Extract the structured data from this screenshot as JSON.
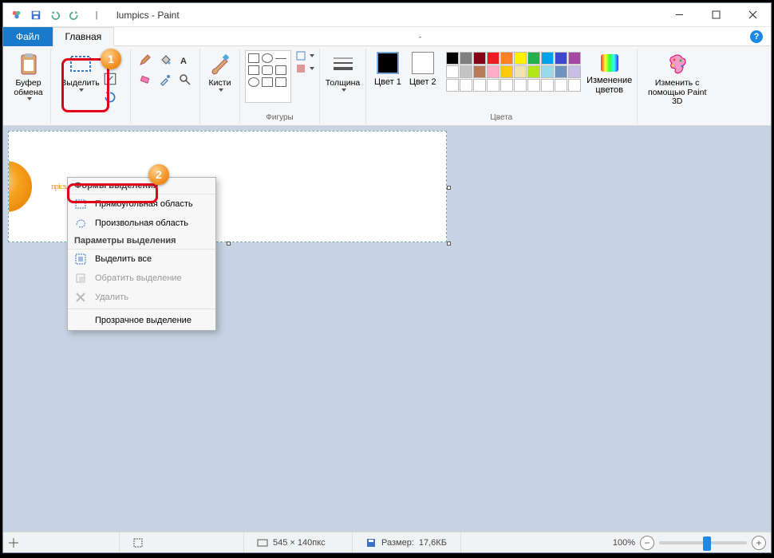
{
  "window": {
    "title": "lumpics - Paint"
  },
  "tabs": {
    "file": "Файл",
    "home": "Главная"
  },
  "ribbon": {
    "clipboard": {
      "label": "Буфер обмена",
      "paste": "Буфер обмена"
    },
    "image": {
      "select": "Выделить"
    },
    "tools": {},
    "brushes": {
      "label": "Кисти"
    },
    "shapes": {
      "label": "Фигуры"
    },
    "thickness": {
      "label": "Толщина"
    },
    "colors": {
      "label": "Цвета",
      "color1": "Цвет 1",
      "color2": "Цвет 2",
      "edit": "Изменение цветов"
    },
    "paint3d": {
      "label": "Изменить с помощью Paint 3D"
    }
  },
  "dropdown": {
    "header1": "Формы выделения",
    "rect": "Прямоугольная область",
    "free": "Произвольная область",
    "header2": "Параметры выделения",
    "all": "Выделить все",
    "invert": "Обратить выделение",
    "delete": "Удалить",
    "transparent": "Прозрачное выделение"
  },
  "canvas": {
    "text": "npics.ru"
  },
  "status": {
    "dims": "545 × 140пкс",
    "size_label": "Размер:",
    "size_val": "17,6КБ",
    "zoom": "100%"
  },
  "palette_colors": [
    "#000000",
    "#7f7f7f",
    "#880015",
    "#ed1c24",
    "#ff7f27",
    "#fff200",
    "#22b14c",
    "#00a2e8",
    "#3f48cc",
    "#a349a4",
    "#ffffff",
    "#c3c3c3",
    "#b97a57",
    "#ffaec9",
    "#ffc90e",
    "#efe4b0",
    "#b5e61d",
    "#99d9ea",
    "#7092be",
    "#c8bfe7",
    "#ffffff",
    "#ffffff",
    "#ffffff",
    "#ffffff",
    "#ffffff",
    "#ffffff",
    "#ffffff",
    "#ffffff",
    "#ffffff",
    "#ffffff"
  ]
}
